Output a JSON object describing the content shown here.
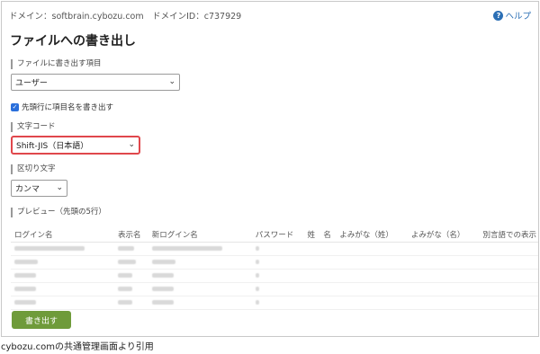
{
  "header": {
    "domain_info": "ドメイン：softbrain.cybozu.com　ドメインID：c737929",
    "help_label": "ヘルプ"
  },
  "page": {
    "title": "ファイルへの書き出し"
  },
  "export_item": {
    "label": "ファイルに書き出す項目",
    "selected": "ユーザー"
  },
  "header_row_checkbox": {
    "label": "先頭行に項目名を書き出す",
    "checked": true
  },
  "encoding": {
    "label": "文字コード",
    "selected": "Shift-JIS（日本語）"
  },
  "delimiter": {
    "label": "区切り文字",
    "selected": "カンマ"
  },
  "preview": {
    "label": "プレビュー（先頭の5行）",
    "columns": [
      "ログイン名",
      "表示名",
      "新ログイン名",
      "パスワード",
      "姓",
      "名",
      "よみがな（姓）",
      "よみがな（名）",
      "別言語での表示"
    ]
  },
  "actions": {
    "export_button": "書き出す"
  },
  "caption": "cybozu.comの共通管理画面より引用",
  "colors": {
    "accent_green": "#6f9b3a",
    "highlight_red": "#e0474c",
    "link_blue": "#2b6fb5"
  }
}
